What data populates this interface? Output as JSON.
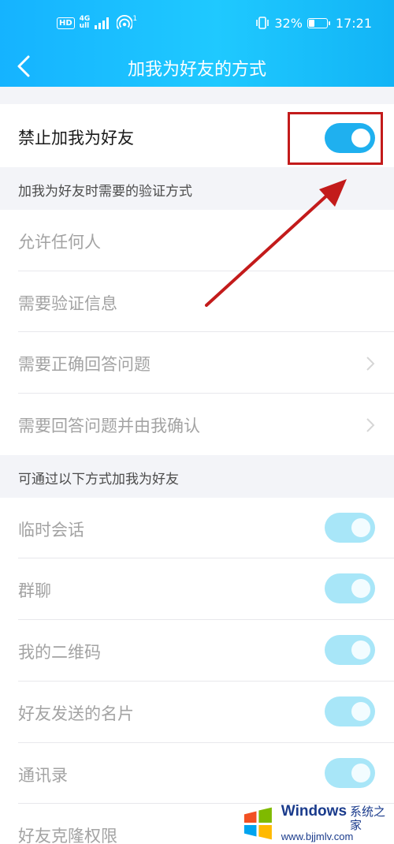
{
  "status_bar": {
    "hd_label": "HD",
    "network_label": "4G",
    "network_sub": "ull",
    "wifi_sup": "1",
    "battery_percent": "32%",
    "battery_level": 0.32,
    "time": "17:21"
  },
  "nav": {
    "title": "加我为好友的方式",
    "back_icon": "chevron-left-icon"
  },
  "main_toggle": {
    "label": "禁止加我为好友",
    "on": true
  },
  "verification_section": {
    "header": "加我为好友时需要的验证方式",
    "items": [
      {
        "label": "允许任何人",
        "has_chevron": false
      },
      {
        "label": "需要验证信息",
        "has_chevron": false
      },
      {
        "label": "需要正确回答问题",
        "has_chevron": true
      },
      {
        "label": "需要回答问题并由我确认",
        "has_chevron": true
      }
    ]
  },
  "methods_section": {
    "header": "可通过以下方式加我为好友",
    "items": [
      {
        "label": "临时会话",
        "on": true
      },
      {
        "label": "群聊",
        "on": true
      },
      {
        "label": "我的二维码",
        "on": true
      },
      {
        "label": "好友发送的名片",
        "on": true
      },
      {
        "label": "通讯录",
        "on": true
      },
      {
        "label": "好友克隆权限",
        "on": false
      }
    ]
  },
  "colors": {
    "header_start": "#15b3ff",
    "header_end": "#12b4f6",
    "toggle_on": "#1fb0ef",
    "toggle_disabled": "#a8e6f8",
    "annotation_red": "#c31b1b",
    "text_active": "#1a1a1a",
    "text_disabled": "#a3a3a3"
  },
  "watermark": {
    "brand": "Windows",
    "brand_cn": "系统之家",
    "url": "www.bjjmlv.com"
  }
}
